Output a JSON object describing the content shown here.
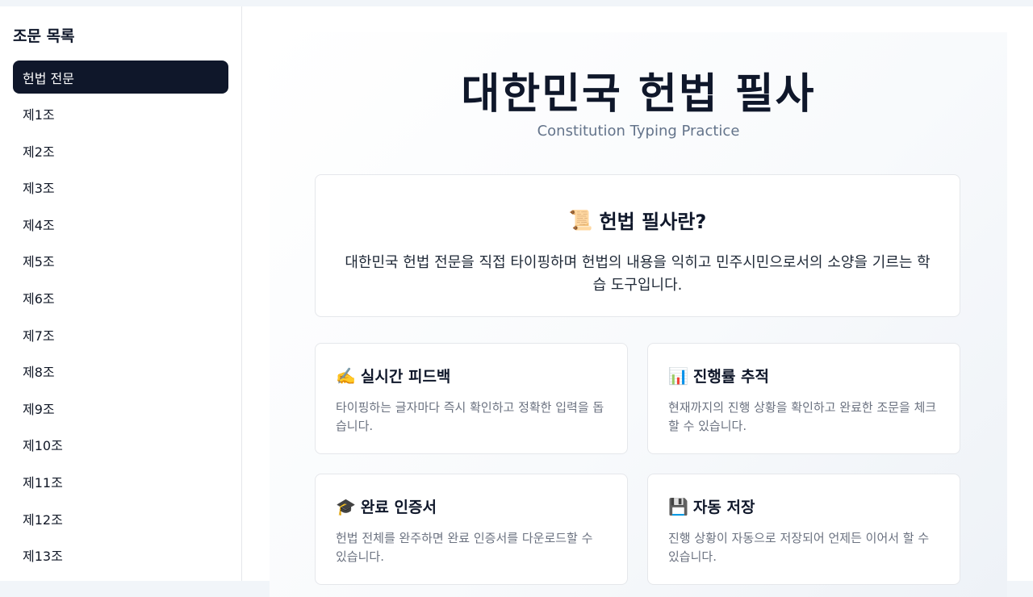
{
  "sidebar": {
    "title": "조문 목록",
    "items": [
      {
        "label": "헌법 전문",
        "active": true
      },
      {
        "label": "제1조"
      },
      {
        "label": "제2조"
      },
      {
        "label": "제3조"
      },
      {
        "label": "제4조"
      },
      {
        "label": "제5조"
      },
      {
        "label": "제6조"
      },
      {
        "label": "제7조"
      },
      {
        "label": "제8조"
      },
      {
        "label": "제9조"
      },
      {
        "label": "제10조"
      },
      {
        "label": "제11조"
      },
      {
        "label": "제12조"
      },
      {
        "label": "제13조"
      }
    ]
  },
  "hero": {
    "title": "대한민국 헌법 필사",
    "subtitle": "Constitution Typing Practice"
  },
  "intro": {
    "icon": "scroll-icon",
    "heading": "헌법 필사란?",
    "text": "대한민국 헌법 전문을 직접 타이핑하며 헌법의 내용을 익히고 민주시민으로서의 소양을 기르는 학습 도구입니다."
  },
  "features": [
    {
      "icon": "writing-hand-icon",
      "title": "실시간 피드백",
      "text": "타이핑하는 글자마다 즉시 확인하고 정확한 입력을 돕습니다."
    },
    {
      "icon": "bar-chart-icon",
      "title": "진행률 추적",
      "text": "현재까지의 진행 상황을 확인하고 완료한 조문을 체크할 수 있습니다."
    },
    {
      "icon": "graduation-cap-icon",
      "title": "완료 인증서",
      "text": "헌법 전체를 완주하면 완료 인증서를 다운로드할 수 있습니다."
    },
    {
      "icon": "floppy-disk-icon",
      "title": "자동 저장",
      "text": "진행 상황이 자동으로 저장되어 언제든 이어서 할 수 있습니다."
    }
  ]
}
